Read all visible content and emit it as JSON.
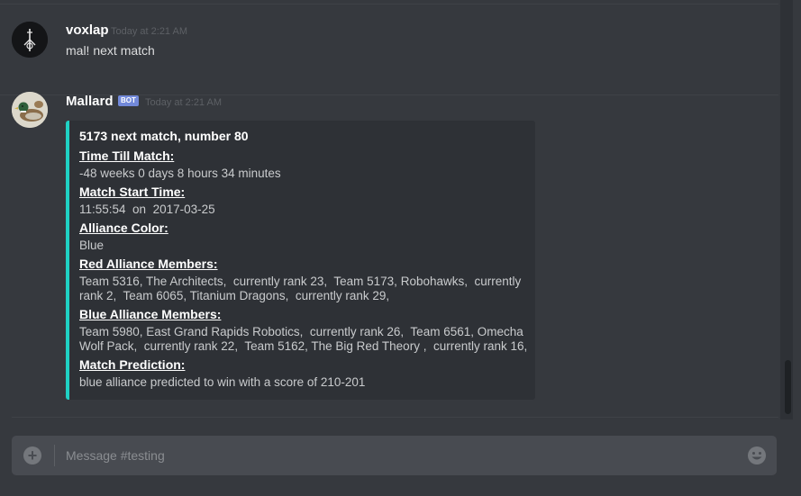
{
  "messages": [
    {
      "username": "voxlap",
      "timestamp": "Today at 2:21 AM",
      "text": "mal! next match",
      "avatar_icon": "black-figure-avatar"
    },
    {
      "username": "Mallard",
      "bot_tag": "BOT",
      "timestamp": "Today at 2:21 AM",
      "avatar_icon": "duck-avatar",
      "embed": {
        "accent_color": "#1fd1c4",
        "title": "5173 next match, number 80",
        "fields": [
          {
            "name": "Time Till Match:",
            "lines": [
              "-48 weeks 0 days 8 hours 34 minutes"
            ]
          },
          {
            "name": "Match Start Time:",
            "lines": [
              "11:55:54  on  2017-03-25"
            ]
          },
          {
            "name": "Alliance Color:",
            "lines": [
              "Blue"
            ]
          },
          {
            "name": "Red Alliance Members:",
            "lines": [
              "Team 5316, The Architects,  currently rank 23,  Team 5173, Robohawks,  currently",
              "rank 2,  Team 6065, Titanium Dragons,  currently rank 29,"
            ]
          },
          {
            "name": "Blue Alliance Members:",
            "lines": [
              "Team 5980, East Grand Rapids Robotics,  currently rank 26,  Team 6561, Omecha",
              "Wolf Pack,  currently rank 22,  Team 5162, The Big Red Theory ,  currently rank 16,"
            ]
          },
          {
            "name": "Match Prediction:",
            "lines": [
              "blue alliance predicted to win with a score of 210-201"
            ]
          }
        ]
      }
    }
  ],
  "composer": {
    "placeholder": "Message #testing",
    "add_icon": "plus-circle-icon",
    "emoji_icon": "smiley-emoji-icon"
  },
  "colors": {
    "background": "#36393e",
    "bot_tag": "#7289da",
    "embed_background": "#2e3136"
  }
}
